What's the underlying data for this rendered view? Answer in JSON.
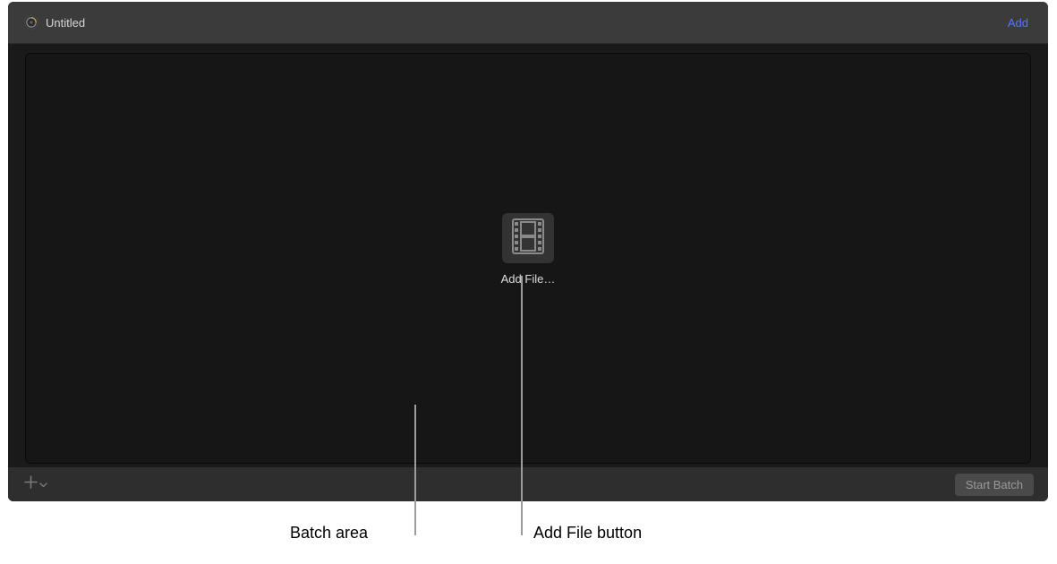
{
  "header": {
    "title": "Untitled",
    "add_label": "Add"
  },
  "batch_area": {
    "add_file_label": "Add File…"
  },
  "footer": {
    "start_batch_label": "Start Batch"
  },
  "callouts": {
    "batch_area": "Batch area",
    "add_file_button": "Add File button"
  }
}
